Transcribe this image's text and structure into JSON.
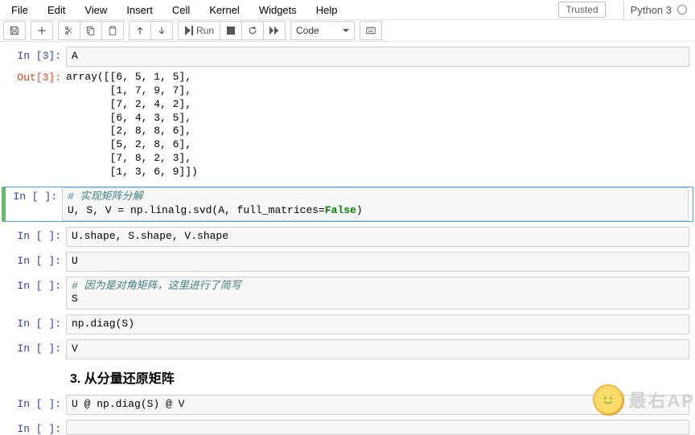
{
  "menu": {
    "items": [
      "File",
      "Edit",
      "View",
      "Insert",
      "Cell",
      "Kernel",
      "Widgets",
      "Help"
    ],
    "trusted": "Trusted",
    "kernel": "Python 3"
  },
  "toolbar": {
    "run": "Run",
    "celltype": "Code"
  },
  "cells": {
    "c0_prompt": "In [3]:",
    "c0_code": "A",
    "c1_prompt": "Out[3]:",
    "c1_out": "array([[6, 5, 1, 5],\n       [1, 7, 9, 7],\n       [7, 2, 4, 2],\n       [6, 4, 3, 5],\n       [2, 8, 8, 6],\n       [5, 2, 8, 6],\n       [7, 8, 2, 3],\n       [1, 3, 6, 9]])",
    "c2_prompt": "In [ ]:",
    "c2_comment": "# 实现矩阵分解",
    "c2_code_a": "U, S, V = np.linalg.svd(A, full_matrices=",
    "c2_code_false": "False",
    "c2_code_b": ")",
    "c3_prompt": "In [ ]:",
    "c3_code": "U.shape, S.shape, V.shape",
    "c4_prompt": "In [ ]:",
    "c4_code": "U",
    "c5_prompt": "In [ ]:",
    "c5_comment": "# 因为是对角矩阵，这里进行了简写",
    "c5_code": "S",
    "c6_prompt": "In [ ]:",
    "c6_code": "np.diag(S)",
    "c7_prompt": "In [ ]:",
    "c7_code": "V",
    "md1": "3. 从分量还原矩阵",
    "c8_prompt": "In [ ]:",
    "c8_code": "U @ np.diag(S) @ V",
    "c9_prompt": "In [ ]:",
    "c9_code": ""
  },
  "watermark": "最右AP"
}
